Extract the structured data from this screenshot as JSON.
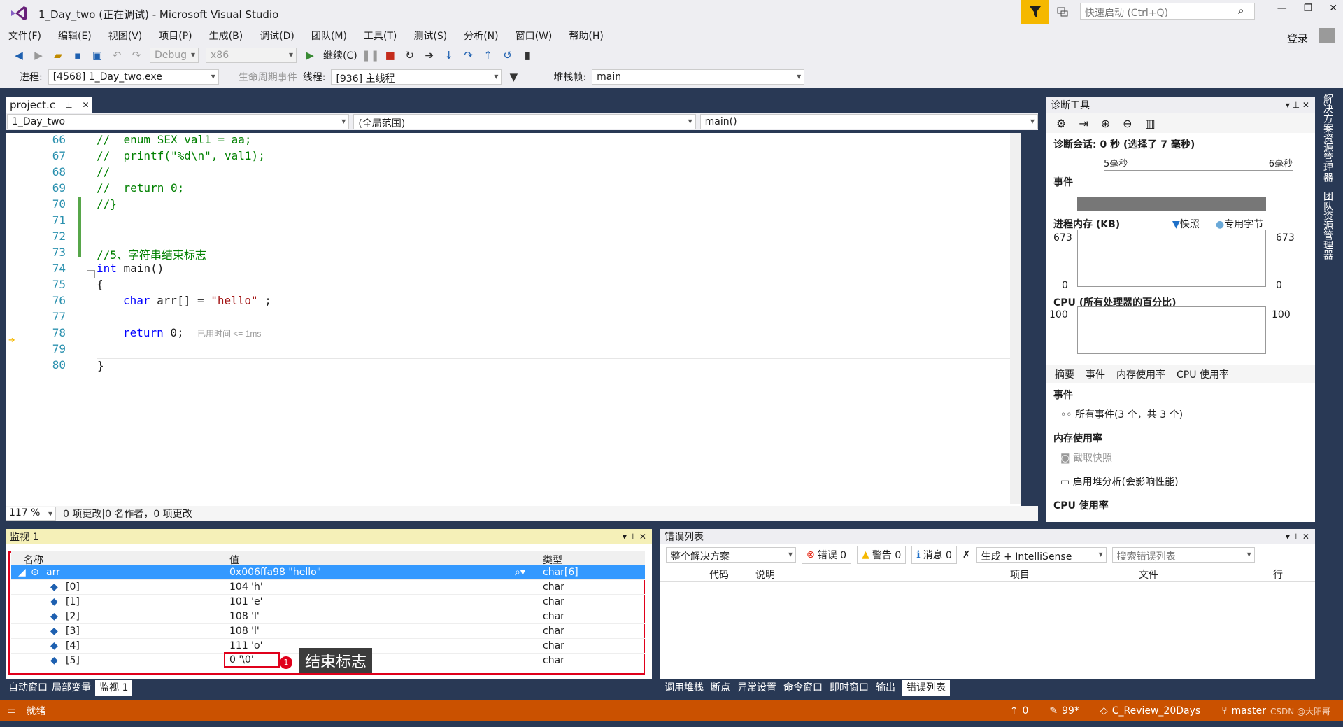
{
  "window": {
    "title": "1_Day_two (正在调试) - Microsoft Visual Studio",
    "quick_launch_placeholder": "快速启动 (Ctrl+Q)",
    "login": "登录"
  },
  "menu": [
    "文件(F)",
    "编辑(E)",
    "视图(V)",
    "项目(P)",
    "生成(B)",
    "调试(D)",
    "团队(M)",
    "工具(T)",
    "测试(S)",
    "分析(N)",
    "窗口(W)",
    "帮助(H)"
  ],
  "toolbar": {
    "config": "Debug",
    "platform": "x86",
    "continue": "继续(C)"
  },
  "debugbar": {
    "process_label": "进程:",
    "process": "[4568] 1_Day_two.exe",
    "lifecycle": "生命周期事件",
    "thread_label": "线程:",
    "thread": "[936] 主线程",
    "stack_label": "堆栈帧:",
    "stack": "main"
  },
  "editor": {
    "tab": "project.c",
    "nav": {
      "project": "1_Day_two",
      "scope": "(全局范围)",
      "func": "main()"
    },
    "lines": [
      {
        "n": "66",
        "text": "//  enum SEX val1 = aa;"
      },
      {
        "n": "67",
        "text": "//  printf(\"%d\\n\", val1);"
      },
      {
        "n": "68",
        "text": "//"
      },
      {
        "n": "69",
        "text": "//  return 0;"
      },
      {
        "n": "70",
        "text": "//}"
      },
      {
        "n": "71",
        "text": ""
      },
      {
        "n": "72",
        "text": ""
      },
      {
        "n": "73",
        "text": "//5、字符串结束标志"
      },
      {
        "n": "74",
        "kw": "int",
        "text": " main()"
      },
      {
        "n": "75",
        "text": "{"
      },
      {
        "n": "76",
        "kw": "char",
        "text": " arr[] = ",
        "str": "\"hello\"",
        "tail": " ;"
      },
      {
        "n": "77",
        "text": ""
      },
      {
        "n": "78",
        "kw": "return",
        "text": " 0;",
        "time": "已用时间 <= 1ms"
      },
      {
        "n": "79",
        "text": ""
      },
      {
        "n": "80",
        "text": "}"
      }
    ],
    "zoom": "117 %",
    "status": "0 项更改|0 名作者，0 项更改"
  },
  "diag": {
    "title": "诊断工具",
    "session": "诊断会话: 0 秒 (选择了 7 毫秒)",
    "t1": "5毫秒",
    "t2": "6毫秒",
    "events": "事件",
    "memory": "进程内存 (KB)",
    "snapshot": "快照",
    "private": "专用字节",
    "mem_max": "673",
    "mem_min": "0",
    "cpu": "CPU (所有处理器的百分比)",
    "cpu_max": "100",
    "tabs": [
      "摘要",
      "事件",
      "内存使用率",
      "CPU 使用率"
    ],
    "events_hdr": "事件",
    "all_events": "所有事件(3 个，共 3 个)",
    "mem_hdr": "内存使用率",
    "take_snapshot": "截取快照",
    "heap": "启用堆分析(会影响性能)",
    "cpu_hdr": "CPU 使用率"
  },
  "watch": {
    "title": "监视 1",
    "cols": [
      "名称",
      "值",
      "类型"
    ],
    "rows": [
      {
        "name": "arr",
        "value": "0x006ffa98 \"hello\"",
        "type": "char[6]"
      },
      {
        "name": "[0]",
        "value": "104 'h'",
        "type": "char"
      },
      {
        "name": "[1]",
        "value": "101 'e'",
        "type": "char"
      },
      {
        "name": "[2]",
        "value": "108 'l'",
        "type": "char"
      },
      {
        "name": "[3]",
        "value": "108 'l'",
        "type": "char"
      },
      {
        "name": "[4]",
        "value": "111 'o'",
        "type": "char"
      },
      {
        "name": "[5]",
        "value": "0 '\\0'",
        "type": "char"
      }
    ],
    "annotation": "结束标志",
    "tabs": [
      "自动窗口",
      "局部变量",
      "监视 1"
    ]
  },
  "errors": {
    "title": "错误列表",
    "scope": "整个解决方案",
    "err": "错误 0",
    "warn": "警告 0",
    "msg": "消息 0",
    "build": "生成 + IntelliSense",
    "search": "搜索错误列表",
    "cols": [
      "代码",
      "说明",
      "项目",
      "文件",
      "行"
    ],
    "tabs": [
      "调用堆栈",
      "断点",
      "异常设置",
      "命令窗口",
      "即时窗口",
      "输出",
      "错误列表"
    ]
  },
  "statusbar": {
    "ready": "就绪",
    "up": "0",
    "pencil": "99*",
    "repo": "C_Review_20Days",
    "branch": "master",
    "watermark": "CSDN @大阳哥"
  },
  "colors": {
    "accent": "#007acc",
    "status": "#ca5100",
    "highlight_red": "#e0001b"
  }
}
